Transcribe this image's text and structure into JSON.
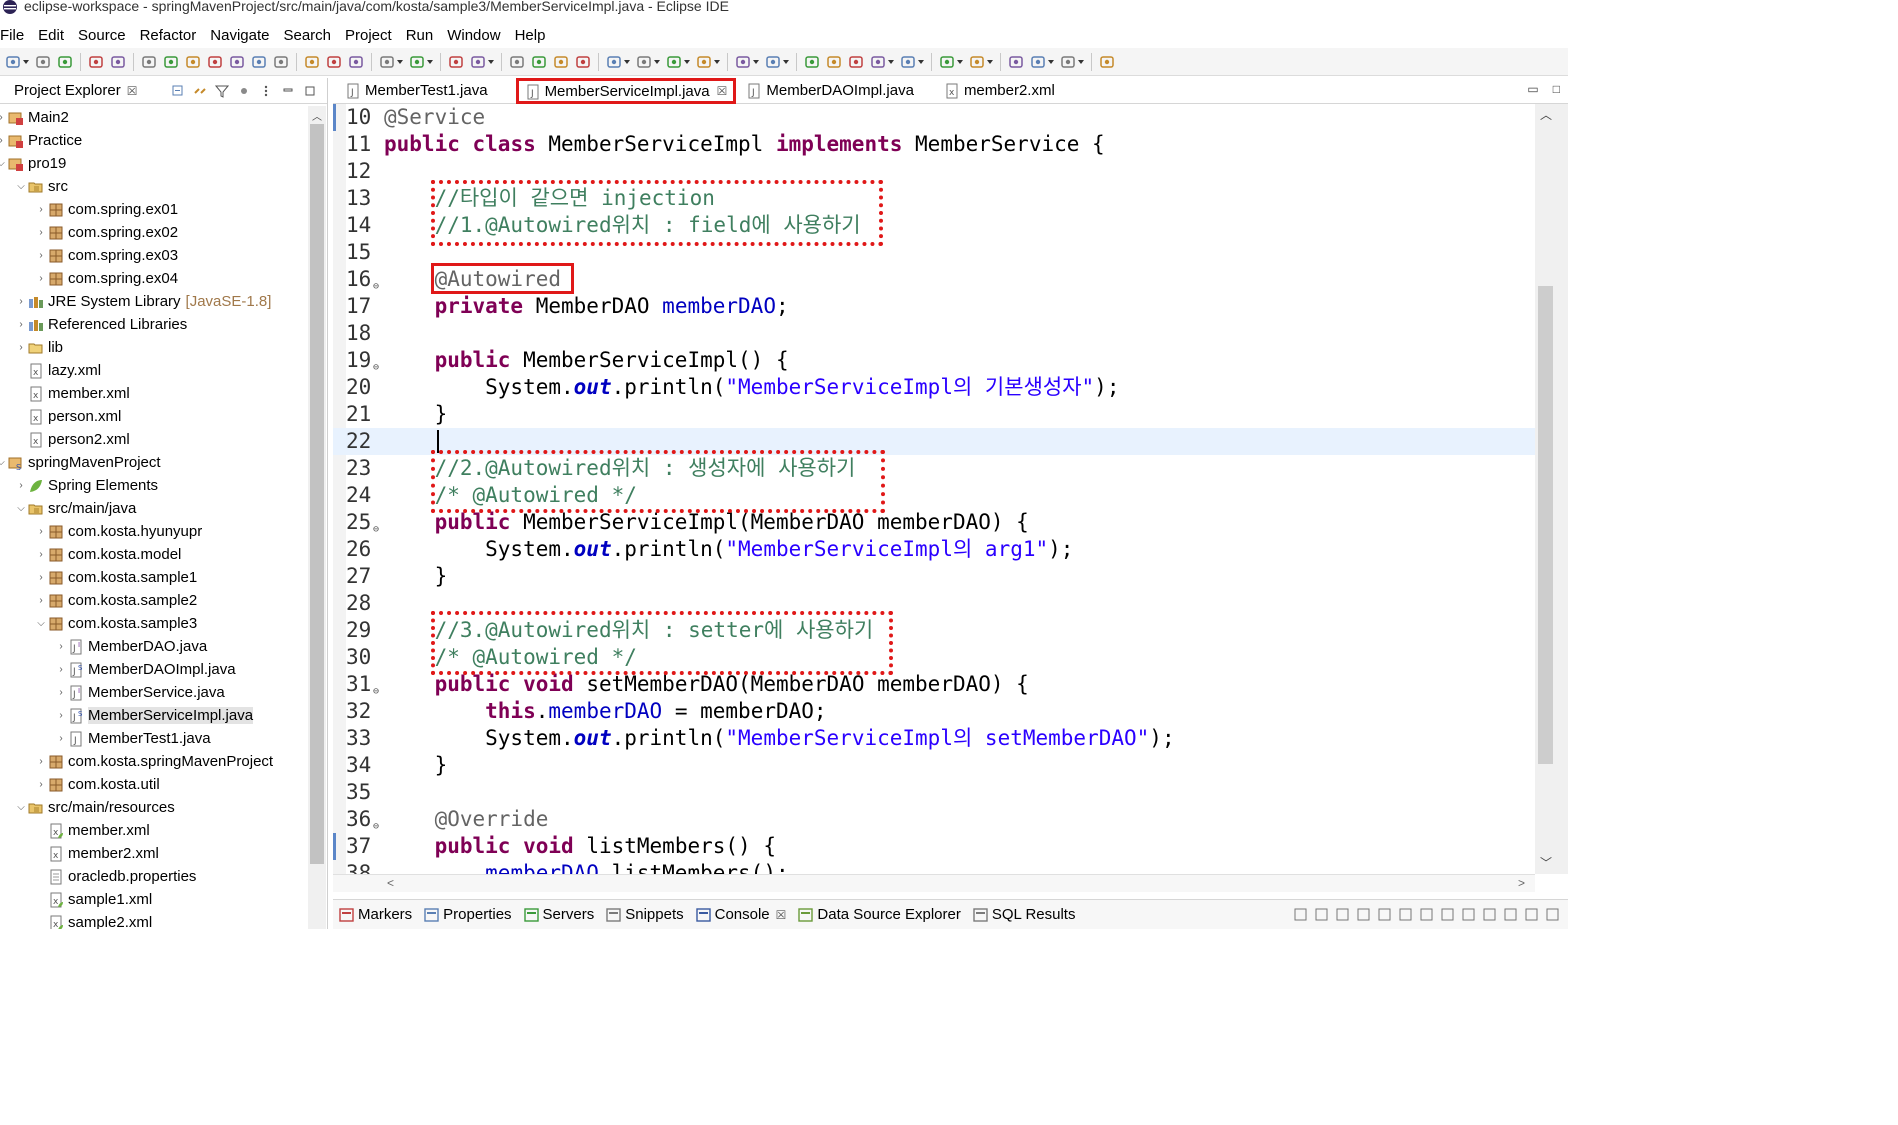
{
  "window": {
    "title": "eclipse-workspace - springMavenProject/src/main/java/com/kosta/sample3/MemberServiceImpl.java - Eclipse IDE"
  },
  "menu": [
    "File",
    "Edit",
    "Source",
    "Refactor",
    "Navigate",
    "Search",
    "Project",
    "Run",
    "Window",
    "Help"
  ],
  "project_explorer": {
    "title": "Project Explorer",
    "close_glyph": "☒",
    "items": [
      {
        "label": "Main2",
        "depth": 0,
        "expanded": false,
        "icon": "project-icon"
      },
      {
        "label": "Practice",
        "depth": 0,
        "expanded": false,
        "icon": "project-icon"
      },
      {
        "label": "pro19",
        "depth": 0,
        "expanded": true,
        "icon": "project-icon"
      },
      {
        "label": "src",
        "depth": 1,
        "expanded": true,
        "icon": "source-folder-icon"
      },
      {
        "label": "com.spring.ex01",
        "depth": 2,
        "expanded": false,
        "icon": "package-icon"
      },
      {
        "label": "com.spring.ex02",
        "depth": 2,
        "expanded": false,
        "icon": "package-icon"
      },
      {
        "label": "com.spring.ex03",
        "depth": 2,
        "expanded": false,
        "icon": "package-icon"
      },
      {
        "label": "com.spring.ex04",
        "depth": 2,
        "expanded": false,
        "icon": "package-icon"
      },
      {
        "label": "JRE System Library",
        "extra": "[JavaSE-1.8]",
        "depth": 1,
        "expanded": false,
        "icon": "library-icon"
      },
      {
        "label": "Referenced Libraries",
        "depth": 1,
        "expanded": false,
        "icon": "library-icon"
      },
      {
        "label": "lib",
        "depth": 1,
        "expanded": false,
        "icon": "folder-icon"
      },
      {
        "label": "lazy.xml",
        "depth": 1,
        "leaf": true,
        "icon": "xml-file-icon"
      },
      {
        "label": "member.xml",
        "depth": 1,
        "leaf": true,
        "icon": "xml-file-icon"
      },
      {
        "label": "person.xml",
        "depth": 1,
        "leaf": true,
        "icon": "xml-file-icon"
      },
      {
        "label": "person2.xml",
        "depth": 1,
        "leaf": true,
        "icon": "xml-file-icon"
      },
      {
        "label": "springMavenProject",
        "depth": 0,
        "expanded": true,
        "icon": "maven-project-icon"
      },
      {
        "label": "Spring Elements",
        "depth": 1,
        "expanded": false,
        "icon": "spring-icon"
      },
      {
        "label": "src/main/java",
        "depth": 1,
        "expanded": true,
        "icon": "source-folder-icon"
      },
      {
        "label": "com.kosta.hyunyupr",
        "depth": 2,
        "expanded": false,
        "icon": "package-icon"
      },
      {
        "label": "com.kosta.model",
        "depth": 2,
        "expanded": false,
        "icon": "package-icon"
      },
      {
        "label": "com.kosta.sample1",
        "depth": 2,
        "expanded": false,
        "icon": "package-icon"
      },
      {
        "label": "com.kosta.sample2",
        "depth": 2,
        "expanded": false,
        "icon": "package-icon"
      },
      {
        "label": "com.kosta.sample3",
        "depth": 2,
        "expanded": true,
        "icon": "package-icon"
      },
      {
        "label": "MemberDAO.java",
        "depth": 3,
        "expanded": false,
        "icon": "interface-file-icon"
      },
      {
        "label": "MemberDAOImpl.java",
        "depth": 3,
        "expanded": false,
        "icon": "spring-java-file-icon"
      },
      {
        "label": "MemberService.java",
        "depth": 3,
        "expanded": false,
        "icon": "interface-file-icon"
      },
      {
        "label": "MemberServiceImpl.java",
        "depth": 3,
        "expanded": false,
        "selected": true,
        "icon": "spring-java-file-icon"
      },
      {
        "label": "MemberTest1.java",
        "depth": 3,
        "expanded": false,
        "icon": "java-file-icon"
      },
      {
        "label": "com.kosta.springMavenProject",
        "depth": 2,
        "expanded": false,
        "icon": "package-icon"
      },
      {
        "label": "com.kosta.util",
        "depth": 2,
        "expanded": false,
        "icon": "package-icon"
      },
      {
        "label": "src/main/resources",
        "depth": 1,
        "expanded": true,
        "icon": "source-folder-icon"
      },
      {
        "label": "member.xml",
        "depth": 2,
        "leaf": true,
        "icon": "spring-xml-file-icon"
      },
      {
        "label": "member2.xml",
        "depth": 2,
        "leaf": true,
        "icon": "xml-file-icon"
      },
      {
        "label": "oracledb.properties",
        "depth": 2,
        "leaf": true,
        "icon": "properties-file-icon"
      },
      {
        "label": "sample1.xml",
        "depth": 2,
        "leaf": true,
        "icon": "spring-xml-file-icon"
      },
      {
        "label": "sample2.xml",
        "depth": 2,
        "leaf": true,
        "icon": "spring-xml-file-icon"
      }
    ]
  },
  "editor_tabs": [
    {
      "label": "MemberTest1.java",
      "active": false,
      "icon": "java-file-icon"
    },
    {
      "label": "MemberServiceImpl.java",
      "active": true,
      "icon": "java-file-icon",
      "close_glyph": "☒"
    },
    {
      "label": "MemberDAOImpl.java",
      "active": false,
      "icon": "java-file-icon"
    },
    {
      "label": "member2.xml",
      "active": false,
      "icon": "xml-file-icon"
    }
  ],
  "code": {
    "current_line": 22,
    "lines": [
      {
        "n": "10",
        "fold": "",
        "tokens": [
          [
            "an",
            "@Service"
          ]
        ]
      },
      {
        "n": "11",
        "fold": "",
        "tokens": [
          [
            "kw",
            "public"
          ],
          [
            "",
            " "
          ],
          [
            "kw",
            "class"
          ],
          [
            "",
            " MemberServiceImpl "
          ],
          [
            "kw",
            "implements"
          ],
          [
            "",
            " MemberService {"
          ]
        ]
      },
      {
        "n": "12",
        "fold": "",
        "tokens": []
      },
      {
        "n": "13",
        "fold": "",
        "tokens": [
          [
            "",
            "    "
          ],
          [
            "cm",
            "//타입이 같으면 injection"
          ]
        ]
      },
      {
        "n": "14",
        "fold": "",
        "tokens": [
          [
            "",
            "    "
          ],
          [
            "cm",
            "//1.@Autowired위치 : field에 사용하기"
          ]
        ]
      },
      {
        "n": "15",
        "fold": "",
        "tokens": []
      },
      {
        "n": "16",
        "fold": "⊖",
        "tokens": [
          [
            "",
            "    "
          ],
          [
            "an",
            "@Autowired"
          ]
        ]
      },
      {
        "n": "17",
        "fold": "",
        "tokens": [
          [
            "",
            "    "
          ],
          [
            "kw",
            "private"
          ],
          [
            "",
            " MemberDAO "
          ],
          [
            "fd",
            "memberDAO"
          ],
          [
            "",
            ";"
          ]
        ]
      },
      {
        "n": "18",
        "fold": "",
        "tokens": []
      },
      {
        "n": "19",
        "fold": "⊖",
        "tokens": [
          [
            "",
            "    "
          ],
          [
            "kw",
            "public"
          ],
          [
            "",
            " MemberServiceImpl() {"
          ]
        ]
      },
      {
        "n": "20",
        "fold": "",
        "tokens": [
          [
            "",
            "        System."
          ],
          [
            "sf",
            "out"
          ],
          [
            "",
            ".println("
          ],
          [
            "st",
            "\"MemberServiceImpl의 기본생성자\""
          ],
          [
            "",
            ");"
          ]
        ]
      },
      {
        "n": "21",
        "fold": "",
        "tokens": [
          [
            "",
            "    }"
          ]
        ]
      },
      {
        "n": "22",
        "fold": "",
        "tokens": []
      },
      {
        "n": "23",
        "fold": "",
        "tokens": [
          [
            "",
            "    "
          ],
          [
            "cm",
            "//2.@Autowired위치 : 생성자에 사용하기"
          ]
        ]
      },
      {
        "n": "24",
        "fold": "",
        "tokens": [
          [
            "",
            "    "
          ],
          [
            "cm",
            "/* @Autowired */"
          ]
        ]
      },
      {
        "n": "25",
        "fold": "⊖",
        "tokens": [
          [
            "",
            "    "
          ],
          [
            "kw",
            "public"
          ],
          [
            "",
            " MemberServiceImpl(MemberDAO memberDAO) {"
          ]
        ]
      },
      {
        "n": "26",
        "fold": "",
        "tokens": [
          [
            "",
            "        System."
          ],
          [
            "sf",
            "out"
          ],
          [
            "",
            ".println("
          ],
          [
            "st",
            "\"MemberServiceImpl의 arg1\""
          ],
          [
            "",
            ");"
          ]
        ]
      },
      {
        "n": "27",
        "fold": "",
        "tokens": [
          [
            "",
            "    }"
          ]
        ]
      },
      {
        "n": "28",
        "fold": "",
        "tokens": []
      },
      {
        "n": "29",
        "fold": "",
        "tokens": [
          [
            "",
            "    "
          ],
          [
            "cm",
            "//3.@Autowired위치 : setter에 사용하기"
          ]
        ]
      },
      {
        "n": "30",
        "fold": "",
        "tokens": [
          [
            "",
            "    "
          ],
          [
            "cm",
            "/* @Autowired */"
          ]
        ]
      },
      {
        "n": "31",
        "fold": "⊖",
        "tokens": [
          [
            "",
            "    "
          ],
          [
            "kw",
            "public"
          ],
          [
            "",
            " "
          ],
          [
            "kw",
            "void"
          ],
          [
            "",
            " setMemberDAO(MemberDAO memberDAO) {"
          ]
        ]
      },
      {
        "n": "32",
        "fold": "",
        "tokens": [
          [
            "",
            "        "
          ],
          [
            "kw",
            "this"
          ],
          [
            "",
            "."
          ],
          [
            "fd",
            "memberDAO"
          ],
          [
            "",
            " = memberDAO;"
          ]
        ]
      },
      {
        "n": "33",
        "fold": "",
        "tokens": [
          [
            "",
            "        System."
          ],
          [
            "sf",
            "out"
          ],
          [
            "",
            ".println("
          ],
          [
            "st",
            "\"MemberServiceImpl의 setMemberDAO\""
          ],
          [
            "",
            ");"
          ]
        ]
      },
      {
        "n": "34",
        "fold": "",
        "tokens": [
          [
            "",
            "    }"
          ]
        ]
      },
      {
        "n": "35",
        "fold": "",
        "tokens": []
      },
      {
        "n": "36",
        "fold": "⊖",
        "tokens": [
          [
            "",
            "    "
          ],
          [
            "an",
            "@Override"
          ]
        ]
      },
      {
        "n": "37",
        "fold": "",
        "tokens": [
          [
            "",
            "    "
          ],
          [
            "kw",
            "public"
          ],
          [
            "",
            " "
          ],
          [
            "kw",
            "void"
          ],
          [
            "",
            " listMembers() {"
          ]
        ]
      },
      {
        "n": "38",
        "fold": "",
        "tokens": [
          [
            "",
            "        "
          ],
          [
            "fd",
            "memberDAO"
          ],
          [
            "",
            ".listMembers();"
          ]
        ]
      }
    ]
  },
  "bottom_tabs": [
    {
      "label": "Markers",
      "icon": "markers-icon"
    },
    {
      "label": "Properties",
      "icon": "properties-icon"
    },
    {
      "label": "Servers",
      "icon": "servers-icon"
    },
    {
      "label": "Snippets",
      "icon": "snippets-icon"
    },
    {
      "label": "Console",
      "icon": "console-icon",
      "close_glyph": "☒"
    },
    {
      "label": "Data Source Explorer",
      "icon": "data-source-icon"
    },
    {
      "label": "SQL Results",
      "icon": "sql-results-icon"
    }
  ],
  "colors": {
    "annotation_red": "#e01818",
    "keyword": "#7f0055",
    "comment": "#3f7f5f",
    "string": "#2a00ff",
    "field": "#0000c0",
    "annotation": "#646464",
    "current_line_bg": "#e8f2fe"
  }
}
